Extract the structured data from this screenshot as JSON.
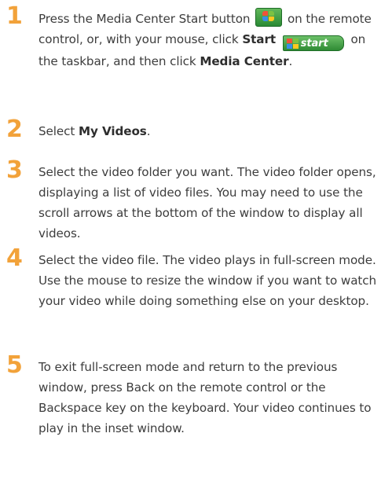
{
  "steps": [
    {
      "number": "1",
      "text_a": "Press the Media Center Start button",
      "text_b": "on the remote control, or, with your mouse, click",
      "start_bold": "Start",
      "start_button_label": "start",
      "text_c": "on the taskbar, and then click",
      "media_center_bold": "Media Center",
      "text_d": "."
    },
    {
      "number": "2",
      "text_a": "Select",
      "bold": "My Videos",
      "text_b": "."
    },
    {
      "number": "3",
      "text": "Select the video folder you want. The video folder opens, displaying a list of video files. You may need to use the scroll arrows at the bottom of the window to display all videos."
    },
    {
      "number": "4",
      "text": "Select the video file. The video plays in full-screen mode. Use the mouse to resize the window if you want to watch your video while doing something else on your desktop."
    },
    {
      "number": "5",
      "text": "To exit full-screen mode and return to the previous window, press Back on the remote control or the Backspace key on the keyboard. Your video continues to play in the inset window."
    }
  ],
  "icons": {
    "media_center_start": "windows-logo-icon",
    "taskbar_start": "start-button-icon"
  },
  "colors": {
    "step_number": "#f2a23a",
    "body_text": "#3d3d3d",
    "start_green": "#3a9a3f"
  }
}
